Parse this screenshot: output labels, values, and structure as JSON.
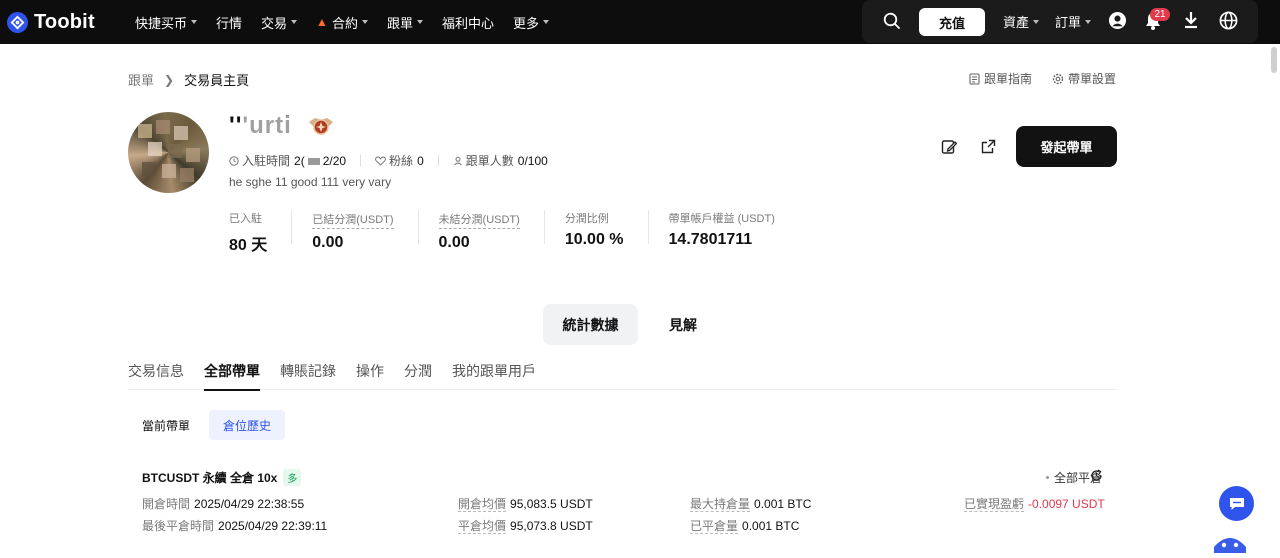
{
  "header": {
    "brand": "Toobit",
    "nav": [
      {
        "label": "快捷买币",
        "caret": true
      },
      {
        "label": "行情",
        "caret": false
      },
      {
        "label": "交易",
        "caret": true
      },
      {
        "label": "合約",
        "caret": true,
        "icon": "fire-icon"
      },
      {
        "label": "跟單",
        "caret": true
      },
      {
        "label": "福利中心",
        "caret": false
      },
      {
        "label": "更多",
        "caret": true
      }
    ],
    "deposit_label": "充值",
    "assets_label": "資產",
    "orders_label": "訂單",
    "notification_count": "21"
  },
  "breadcrumb": {
    "parent": "跟單",
    "current": "交易員主頁"
  },
  "links": {
    "guide": "跟單指南",
    "settings": "帶單設置"
  },
  "profile": {
    "nickname": "'''urti",
    "joined_label": "入駐時間",
    "joined_value_prefix": "2(",
    "joined_value_suffix": "2/20",
    "fans_label": "粉絲",
    "fans_value": "0",
    "followers_label": "跟單人數",
    "followers_value": "0/100",
    "bio": "he sghe 11 good 111 very vary"
  },
  "actions": {
    "launch_label": "發起帶單"
  },
  "stats": [
    {
      "label": "已入駐",
      "value": "80 天",
      "dashed": false
    },
    {
      "label": "已結分潤(USDT)",
      "value": "0.00",
      "dashed": true
    },
    {
      "label": "未結分潤(USDT)",
      "value": "0.00",
      "dashed": true
    },
    {
      "label": "分潤比例",
      "value": "10.00 %",
      "dashed": false
    },
    {
      "label": "帶單帳戶權益 (USDT)",
      "value": "14.7801711",
      "dashed": false
    }
  ],
  "segments": {
    "active": "統計數據",
    "other": "見解"
  },
  "tabs": [
    "交易信息",
    "全部帶單",
    "轉賬記錄",
    "操作",
    "分潤",
    "我的跟單用戶"
  ],
  "active_tab": "全部帶單",
  "subtabs": {
    "current": "當前帶單",
    "history": "倉位歷史"
  },
  "position": {
    "title": "BTCUSDT 永續 全倉 10x",
    "side_tag": "多",
    "status": "全部平倉",
    "open_time_label": "開倉時間",
    "open_time": "2025/04/29 22:38:55",
    "close_time_label": "最後平倉時間",
    "close_time": "2025/04/29 22:39:11",
    "avg_open_label": "開倉均價",
    "avg_open": "95,083.5 USDT",
    "avg_close_label": "平倉均價",
    "avg_close": "95,073.8 USDT",
    "max_pos_label": "最大持倉量",
    "max_pos": "0.001 BTC",
    "closed_qty_label": "已平倉量",
    "closed_qty": "0.001 BTC",
    "pnl_label": "已實現盈虧",
    "pnl": "-0.0097 USDT"
  },
  "colors": {
    "brand": "#2f54eb",
    "negative": "#e03a4c",
    "long": "#12a55a"
  }
}
